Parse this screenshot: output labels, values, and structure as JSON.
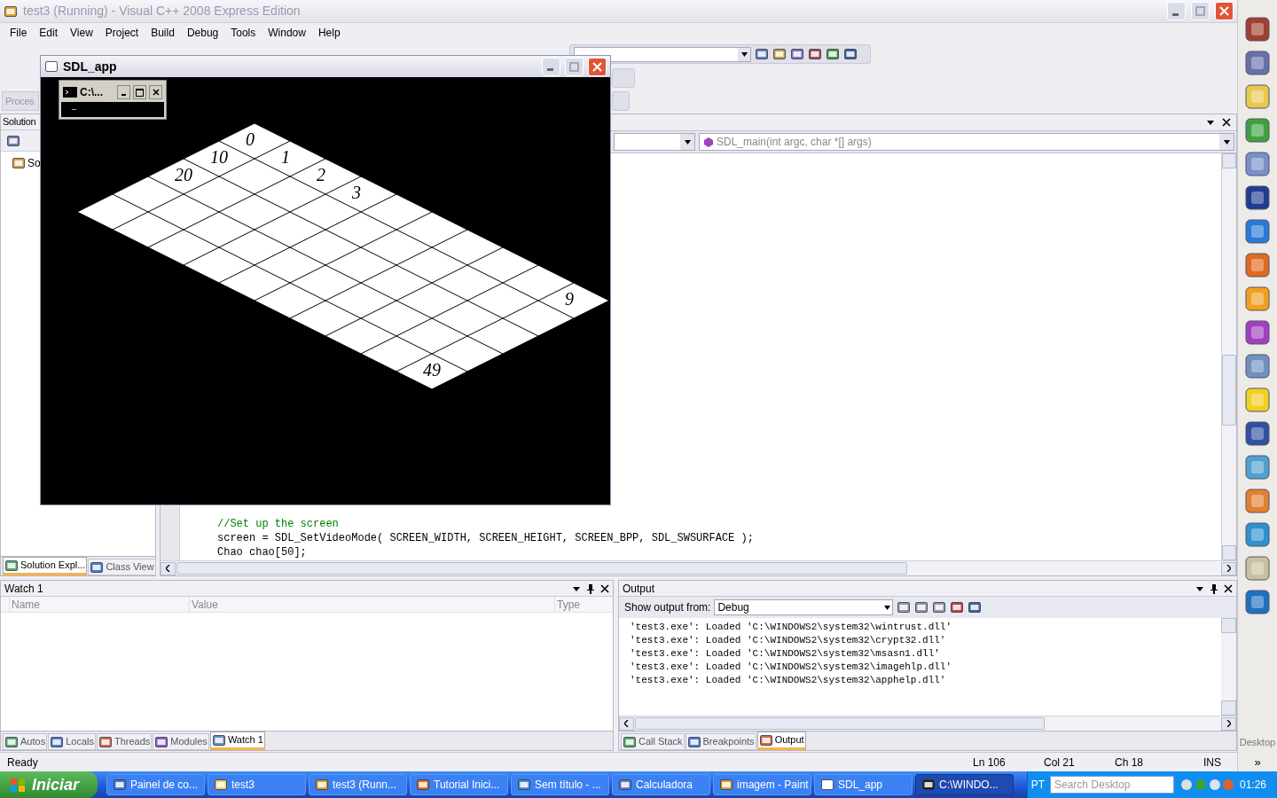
{
  "window": {
    "title": "test3 (Running) - Visual C++ 2008 Express Edition"
  },
  "menu": [
    "File",
    "Edit",
    "View",
    "Project",
    "Build",
    "Debug",
    "Tools",
    "Window",
    "Help"
  ],
  "toolbar": {
    "process_label": "Proces"
  },
  "solution_explorer": {
    "title": "Solution",
    "tree_item": "So",
    "tabs": [
      {
        "label": "Solution Expl...",
        "selected": true
      },
      {
        "label": "Class View",
        "selected": false
      }
    ]
  },
  "editor": {
    "function_combo": "SDL_main(int argc, char *[] args)",
    "code": [
      {
        "kind": "comment",
        "text": "//Set up the screen"
      },
      {
        "kind": "code",
        "text": "screen = SDL_SetVideoMode( SCREEN_WIDTH, SCREEN_HEIGHT, SCREEN_BPP, SDL_SWSURFACE );"
      },
      {
        "kind": "code",
        "text": "Chao chao[50];"
      }
    ]
  },
  "sdl_window": {
    "title": "SDL_app",
    "tile_labels": [
      "0",
      "10",
      "20",
      "1",
      "2",
      "3",
      "9",
      "49"
    ]
  },
  "console_window": {
    "title": "C:\\...",
    "cursor": "_"
  },
  "watch": {
    "title": "Watch 1",
    "columns": [
      "Name",
      "Value",
      "Type"
    ],
    "tabs": [
      {
        "label": "Autos",
        "selected": false
      },
      {
        "label": "Locals",
        "selected": false
      },
      {
        "label": "Threads",
        "selected": false
      },
      {
        "label": "Modules",
        "selected": false
      },
      {
        "label": "Watch 1",
        "selected": true
      }
    ]
  },
  "output": {
    "title": "Output",
    "source_label": "Show output from:",
    "source": "Debug",
    "lines": [
      "'test3.exe': Loaded 'C:\\WINDOWS2\\system32\\wintrust.dll'",
      "'test3.exe': Loaded 'C:\\WINDOWS2\\system32\\crypt32.dll'",
      "'test3.exe': Loaded 'C:\\WINDOWS2\\system32\\msasn1.dll'",
      "'test3.exe': Loaded 'C:\\WINDOWS2\\system32\\imagehlp.dll'",
      "'test3.exe': Loaded 'C:\\WINDOWS2\\system32\\apphelp.dll'"
    ],
    "tabs": [
      {
        "label": "Call Stack",
        "selected": false
      },
      {
        "label": "Breakpoints",
        "selected": false
      },
      {
        "label": "Output",
        "selected": true
      }
    ]
  },
  "status_bar": {
    "text": "Ready",
    "line": "Ln 106",
    "col": "Col 21",
    "char": "Ch 18",
    "mode": "INS"
  },
  "taskbar": {
    "start": "Iniciar",
    "items": [
      {
        "label": "Painel de co...",
        "selected": false
      },
      {
        "label": "test3",
        "selected": false
      },
      {
        "label": "test3 (Runn...",
        "selected": false
      },
      {
        "label": "Tutorial Inici...",
        "selected": false
      },
      {
        "label": "Sem título - ...",
        "selected": false
      },
      {
        "label": "Calculadora",
        "selected": false
      },
      {
        "label": "imagem - Paint",
        "selected": false
      },
      {
        "label": "SDL_app",
        "selected": false
      },
      {
        "label": "C:\\WINDO...",
        "selected": true
      }
    ],
    "language": "PT",
    "search": {
      "placeholder": "Search Desktop"
    },
    "clock": "01:26"
  },
  "quick_launch": {
    "label": "Desktop",
    "more": "»"
  }
}
